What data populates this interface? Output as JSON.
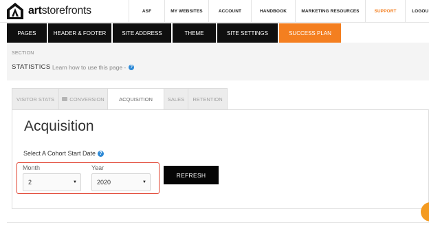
{
  "brand": {
    "logo_bold": "art",
    "logo_rest": "storefronts"
  },
  "topnav": [
    {
      "label": "ASF",
      "name": "topnav-asf"
    },
    {
      "label": "MY WEBSITES",
      "name": "topnav-my-websites"
    },
    {
      "label": "ACCOUNT",
      "name": "topnav-account"
    },
    {
      "label": "HANDBOOK",
      "name": "topnav-handbook"
    },
    {
      "label": "MARKETING RESOURCES",
      "name": "topnav-marketing-resources"
    },
    {
      "label": "SUPPORT",
      "name": "topnav-support"
    },
    {
      "label": "LOGOU",
      "name": "topnav-logout"
    }
  ],
  "subnav": [
    {
      "label": "PAGES",
      "name": "subnav-pages"
    },
    {
      "label": "HEADER & FOOTER",
      "name": "subnav-header-footer"
    },
    {
      "label": "SITE ADDRESS",
      "name": "subnav-site-address"
    },
    {
      "label": "THEME",
      "name": "subnav-theme"
    },
    {
      "label": "SITE SETTINGS",
      "name": "subnav-site-settings"
    },
    {
      "label": "SUCCESS PLAN",
      "name": "subnav-success-plan"
    }
  ],
  "section": {
    "label": "SECTION",
    "title": "STATISTICS",
    "learn_text": "Learn how to use this page -",
    "help_glyph": "?"
  },
  "tabs": [
    {
      "label": "VISITOR STATS",
      "name": "tab-visitor-stats"
    },
    {
      "label": "CONVERSION",
      "name": "tab-conversion",
      "icon": "camera-icon"
    },
    {
      "label": "ACQUISITION",
      "name": "tab-acquisition",
      "active": true
    },
    {
      "label": "SALES",
      "name": "tab-sales"
    },
    {
      "label": "RETENTION",
      "name": "tab-retention"
    }
  ],
  "panel": {
    "heading": "Acquisition",
    "cohort_label": "Select A Cohort Start Date",
    "month_label": "Month",
    "month_value": "2",
    "year_label": "Year",
    "year_value": "2020",
    "select_arrow": "▼",
    "refresh_label": "REFRESH"
  },
  "colors": {
    "accent_orange": "#f47f20",
    "nav_black": "#0f0f0f",
    "help_blue": "#2d89d6",
    "highlight_red": "#e0402e"
  }
}
